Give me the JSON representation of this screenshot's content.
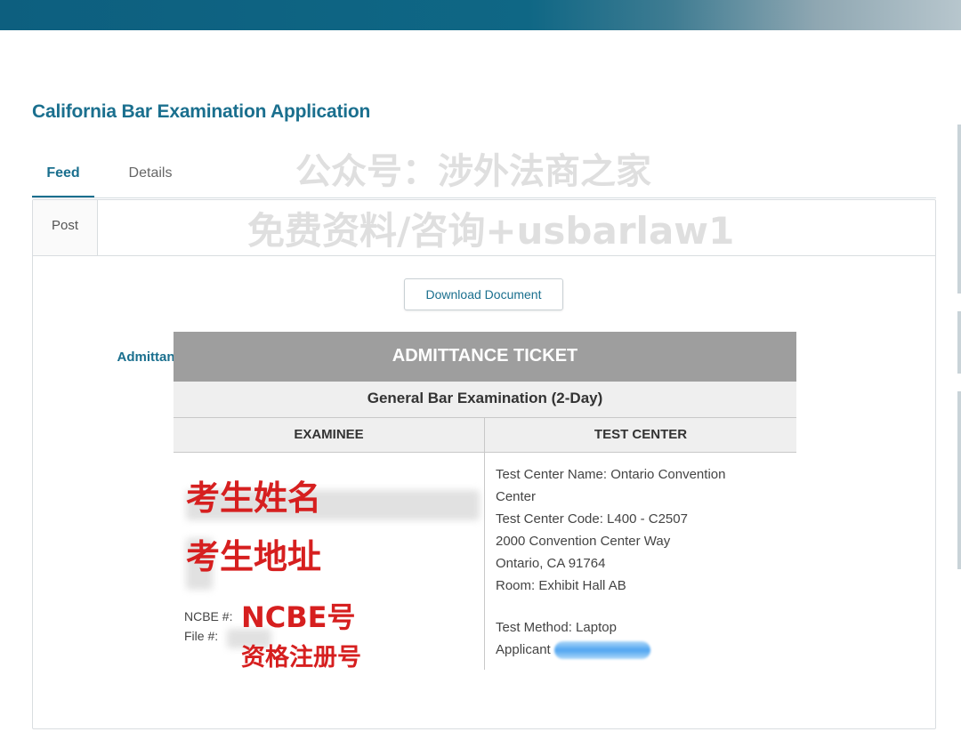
{
  "page": {
    "title": "California Bar Examination Application"
  },
  "main_tabs": [
    {
      "label": "Feed",
      "active": true
    },
    {
      "label": "Details",
      "active": false
    }
  ],
  "sub_tabs": [
    {
      "label": "Post",
      "active": false
    },
    {
      "label": "Admittance Ticket",
      "active": true
    }
  ],
  "download_button": {
    "label": "Download Document"
  },
  "ticket": {
    "header": "ADMITTANCE TICKET",
    "subheader": "General Bar Examination (2-Day)",
    "examinee_heading": "EXAMINEE",
    "test_center_heading": "TEST CENTER",
    "ncbe_label": "NCBE #:",
    "file_label": "File #:",
    "test_center_lines": [
      "Test Center Name: Ontario Convention",
      "Center",
      "Test Center Code: L400 - C2507",
      "2000 Convention Center Way",
      "Ontario,  CA  91764",
      "Room: Exhibit Hall AB"
    ],
    "test_method": "Test Method: Laptop",
    "applicant_label": "Applicant"
  },
  "annotations": {
    "name": "考生姓名",
    "address": "考生地址",
    "ncbe": "NCBE号",
    "file": "资格注册号"
  },
  "watermark": {
    "line1": "公众号：涉外法商之家",
    "line2": "免费资料/咨询+usbarlaw1"
  },
  "colors": {
    "accent": "#1a6f8e",
    "annotation_red": "#d61f1f",
    "ticket_header_gray": "#9e9e9e"
  }
}
